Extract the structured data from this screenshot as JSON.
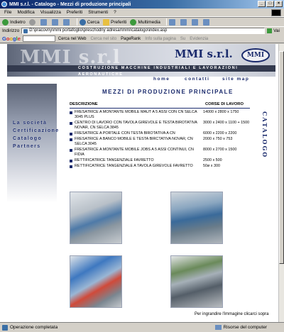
{
  "window": {
    "title": "MMI s.r.l. - Catalogo - Mezzi di produzione principali",
    "controls": [
      "_",
      "□",
      "×"
    ]
  },
  "menubar": {
    "items": [
      "File",
      "Modifica",
      "Visualizza",
      "Preferiti",
      "Strumenti",
      "?"
    ]
  },
  "toolbar": {
    "back_label": "Indietro",
    "search_label": "Cerca",
    "favorites_label": "Preferiti",
    "media_label": "Multimedia"
  },
  "addressbar": {
    "label": "Indirizzo",
    "url": "D:\\pracovny\\mmi portafoglio\\preschodny adresar\\mmi\\catalogo\\index.asp",
    "go_label": "Vai"
  },
  "googlebar": {
    "logo": "Google",
    "search_web": "Cerca nel Web",
    "search_site": "Cerca nel sito",
    "pagerank": "PageRank",
    "page_info": "Info sulla pagina",
    "up": "Su",
    "highlight": "Evidenzia"
  },
  "site": {
    "ghost_logo": "MMI s.r.l",
    "logo_title": "MMI s.r.l.",
    "badge": "MMI",
    "strip_text": "COSTRUZIONE MACCHINE INDUSTRIALI E LAVORAZIONI AERONAUTICHE",
    "topnav": [
      "home",
      "contatti",
      "site map"
    ],
    "sidenav": [
      "La società",
      "Certificazione",
      "Catalogo",
      "Partners"
    ],
    "vertical_label": "CATALOGO",
    "section_title": "MEZZI DI PRODUZIONE PRINCIPALE",
    "table": {
      "col_desc": "DESCRIZIONE",
      "col_dim": "CORSE DI LAVORO",
      "rows": [
        {
          "desc": "FRESATRICE A MONTANTE MOBILE MAUT A 5 ASSI CON CN SELCA 3045 PLUS",
          "dim": "14000 x 2800 x 1750"
        },
        {
          "desc": "CENTRO DI LAVORO CON TAVOLA GIREVOLE E TESTA BIROTATIVA NOVAR, CN SELCA 3845",
          "dim": "3000 x 2400 x 1100 + 1500"
        },
        {
          "desc": "FRESATRICE A PORTALE CON TESTA BIROTATIVA A CN",
          "dim": "6000 x 2200 x 2200"
        },
        {
          "desc": "FRESATRICE A BANCO MOBILE E TESTA BIRCTATIVA NOVAR, CN SELCA 3045",
          "dim": "2000 x 750 x 753"
        },
        {
          "desc": "FRESATRICE A MONTANTE MOBILE JOBS A 5 ASSI CONTINUI, CN FIDIA",
          "dim": "8000 x 2700 x 1500"
        },
        {
          "desc": "RETTIFICATRICE TANGENZIALE FAVRETTO",
          "dim": "2500 x 500"
        },
        {
          "desc": "RETTIFICATRICE TANGENZIALE A TAVOLA GIREVOLE FAVRETTO",
          "dim": "50ø x 300"
        }
      ]
    },
    "caption": "Per ingrandire l'immagine clicarci sopra"
  },
  "statusbar": {
    "left": "Operazione completata",
    "right": "Risorse del computer"
  }
}
